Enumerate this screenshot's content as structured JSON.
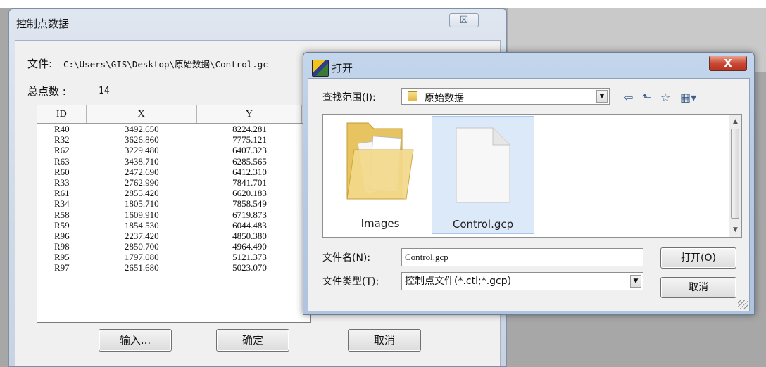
{
  "control_dialog": {
    "title": "控制点数据",
    "close_glyph": "☒",
    "file_label": "文件:",
    "file_path": "C:\\Users\\GIS\\Desktop\\原始数据\\Control.gc",
    "total_label": "总点数 :",
    "total_value": "14",
    "columns": [
      "ID",
      "X",
      "Y"
    ],
    "rows": [
      {
        "id": "R40",
        "x": "3492.650",
        "y": "8224.281"
      },
      {
        "id": "R32",
        "x": "3626.860",
        "y": "7775.121"
      },
      {
        "id": "R62",
        "x": "3229.480",
        "y": "6407.323"
      },
      {
        "id": "R63",
        "x": "3438.710",
        "y": "6285.565"
      },
      {
        "id": "R60",
        "x": "2472.690",
        "y": "6412.310"
      },
      {
        "id": "R33",
        "x": "2762.990",
        "y": "7841.701"
      },
      {
        "id": "R61",
        "x": "2855.420",
        "y": "6620.183"
      },
      {
        "id": "R34",
        "x": "1805.710",
        "y": "7858.549"
      },
      {
        "id": "R58",
        "x": "1609.910",
        "y": "6719.873"
      },
      {
        "id": "R59",
        "x": "1854.530",
        "y": "6044.483"
      },
      {
        "id": "R96",
        "x": "2237.420",
        "y": "4850.380"
      },
      {
        "id": "R98",
        "x": "2850.700",
        "y": "4964.490"
      },
      {
        "id": "R95",
        "x": "1797.080",
        "y": "5121.373"
      },
      {
        "id": "R97",
        "x": "2651.680",
        "y": "5023.070"
      }
    ],
    "buttons": {
      "input": "输入...",
      "ok": "确定",
      "cancel": "取消"
    }
  },
  "open_dialog": {
    "title": "打开",
    "close_glyph": "X",
    "look_in_label": "查找范围(I):",
    "look_in_value": "原始数据",
    "toolbar": {
      "back": "⇦",
      "up": "⬑",
      "new_folder": "☆",
      "view": "▦▾"
    },
    "files": [
      {
        "name": "Images",
        "kind": "folder"
      },
      {
        "name": "Control.gcp",
        "kind": "file",
        "selected": true
      }
    ],
    "filename_label": "文件名(N):",
    "filename_value": "Control.gcp",
    "filetype_label": "文件类型(T):",
    "filetype_value": "控制点文件(*.ctl;*.gcp)",
    "open_button": "打开(O)",
    "cancel_button": "取消"
  }
}
